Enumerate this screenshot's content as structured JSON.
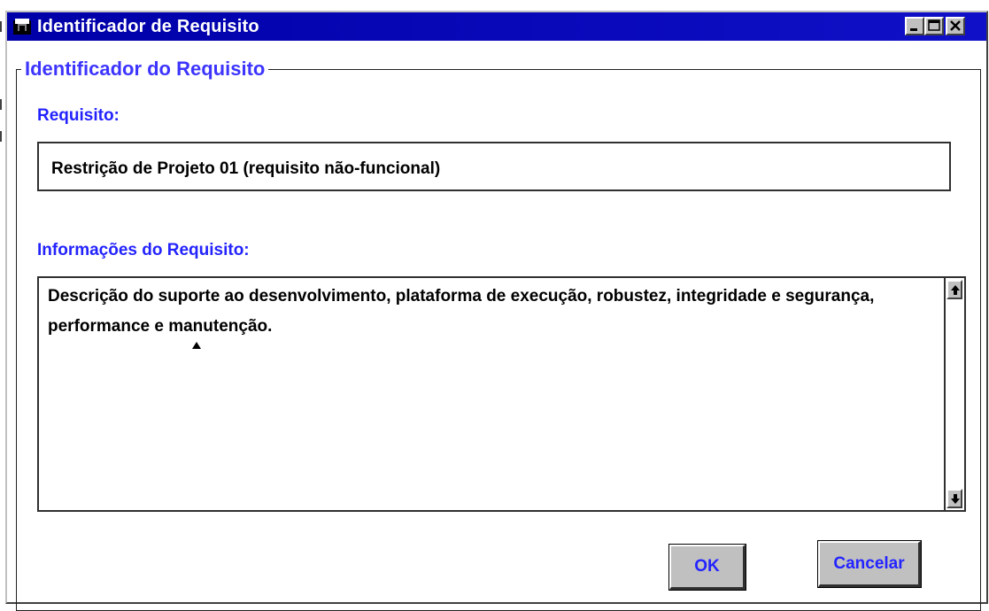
{
  "window": {
    "title": "Identificador de Requisito",
    "icon": "app-icon",
    "controls": {
      "minimize": "minimize-icon",
      "maximize": "maximize-icon",
      "close": "close-icon"
    }
  },
  "group": {
    "title": "Identificador do Requisito"
  },
  "requirement": {
    "label": "Requisito:",
    "value": "Restrição de Projeto 01 (requisito não-funcional)"
  },
  "info": {
    "label": "Informações do Requisito:",
    "value": "Descrição do suporte ao desenvolvimento, plataforma de execução, robustez, integridade e segurança, performance e manutenção."
  },
  "buttons": {
    "ok": "OK",
    "cancel": "Cancelar"
  },
  "colors": {
    "titlebar": "#0000a8",
    "label": "#2323ff",
    "button_face": "#c0c0c0"
  }
}
